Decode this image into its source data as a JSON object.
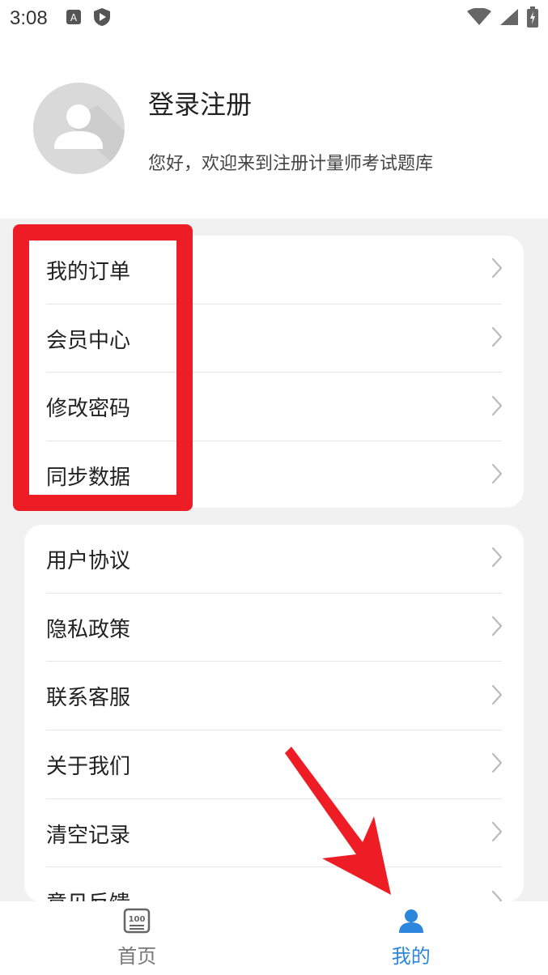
{
  "status_bar": {
    "time": "3:08"
  },
  "profile": {
    "title": "登录注册",
    "subtitle": "您好，欢迎来到注册计量师考试题库"
  },
  "group1": [
    {
      "label": "我的订单"
    },
    {
      "label": "会员中心"
    },
    {
      "label": "修改密码"
    },
    {
      "label": "同步数据"
    }
  ],
  "group2": [
    {
      "label": "用户协议"
    },
    {
      "label": "隐私政策"
    },
    {
      "label": "联系客服"
    },
    {
      "label": "关于我们"
    },
    {
      "label": "清空记录"
    },
    {
      "label": "意见反馈"
    }
  ],
  "bottom_nav": {
    "home_label": "首页",
    "me_label": "我的",
    "active": "me"
  },
  "colors": {
    "accent": "#2b86dc",
    "highlight": "#ee1c25",
    "background": "#f1f1f1"
  }
}
